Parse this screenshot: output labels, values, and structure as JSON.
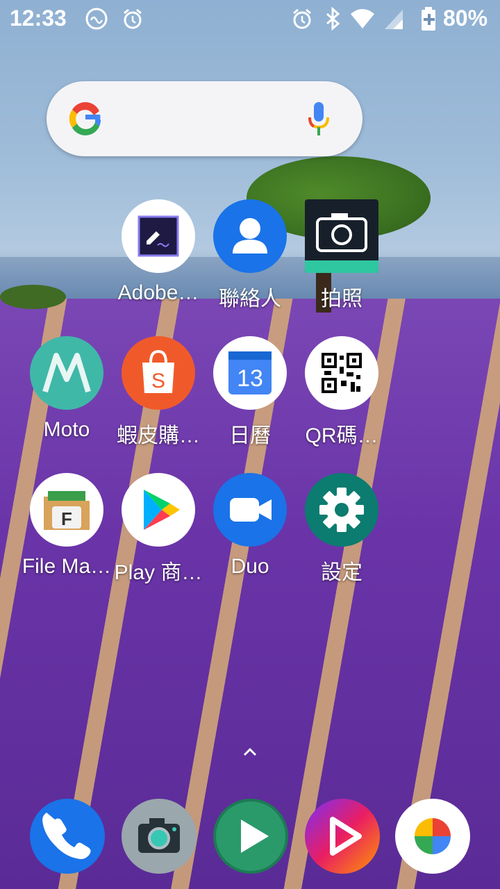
{
  "status_bar": {
    "time": "12:33",
    "battery": "80%",
    "icons": [
      "sync-icon",
      "alarm-icon",
      "alarm-icon",
      "bluetooth-icon",
      "wifi-icon",
      "signal-icon",
      "battery-charging-icon"
    ]
  },
  "search": {
    "provider": "google-icon",
    "mic": "mic-icon"
  },
  "apps": [
    {
      "label": "Adobe…",
      "icon": "adobe-fill-sign-icon",
      "color": "#1f1a44"
    },
    {
      "label": "聯絡人",
      "icon": "contacts-icon",
      "color": "#1a73e8"
    },
    {
      "label": "拍照",
      "icon": "camera-icon",
      "color": "#17202a"
    },
    {
      "label": "Moto",
      "icon": "moto-icon",
      "color": "#3fb8a8"
    },
    {
      "label": "蝦皮購…",
      "icon": "shopee-icon",
      "color": "#f05a2a"
    },
    {
      "label": "日曆",
      "icon": "calendar-icon",
      "color": "#4285f4",
      "detail": "13"
    },
    {
      "label": "QR碼…",
      "icon": "qr-code-icon",
      "color": "#ffffff"
    },
    {
      "label": "File Ma…",
      "icon": "file-manager-icon",
      "color": "#ffffff",
      "detail": "F"
    },
    {
      "label": "Play 商…",
      "icon": "play-store-icon",
      "color": "#ffffff"
    },
    {
      "label": "Duo",
      "icon": "duo-icon",
      "color": "#1a73e8"
    },
    {
      "label": "設定",
      "icon": "settings-icon",
      "color": "#0b7c6f"
    }
  ],
  "dock": [
    {
      "icon": "phone-icon",
      "color": "#1a73e8"
    },
    {
      "icon": "camera-app-icon",
      "color": "#9aa7ad"
    },
    {
      "icon": "play-video-icon",
      "color": "#1e7a55"
    },
    {
      "icon": "music-play-icon",
      "color": "#c2189a"
    },
    {
      "icon": "photos-icon",
      "color": "#ffffff"
    }
  ]
}
